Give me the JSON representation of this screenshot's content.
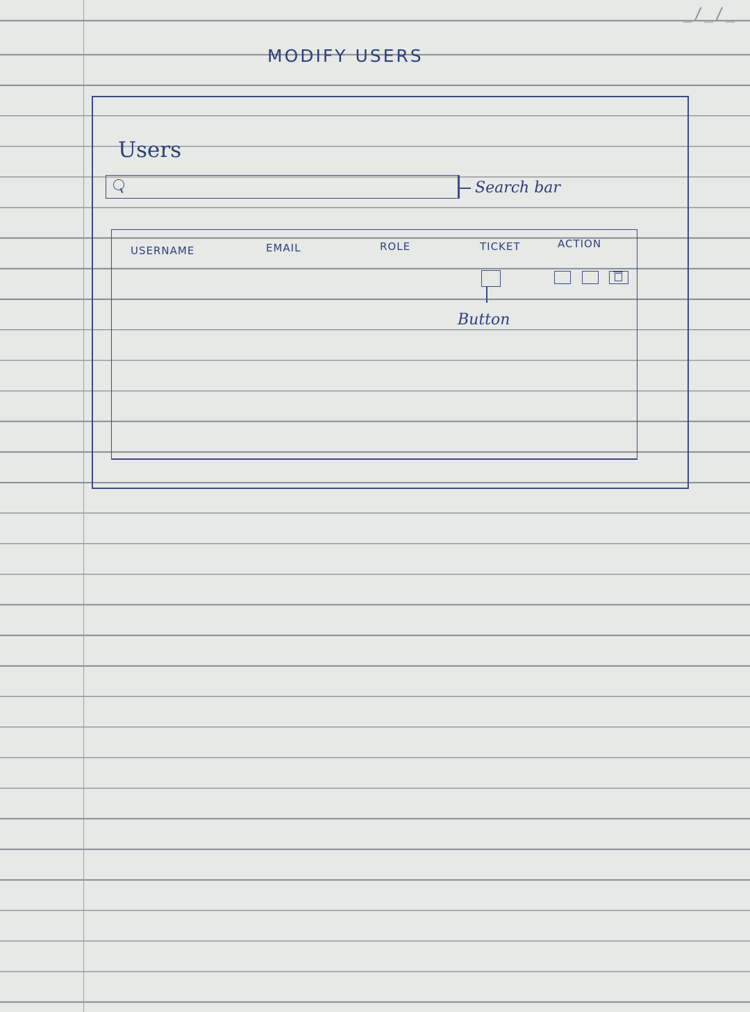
{
  "page": {
    "title": "MODIFY USERS",
    "date_field": "_/_/_"
  },
  "section": {
    "title": "Users"
  },
  "search": {
    "placeholder": "",
    "value": "",
    "annotation": "Search bar"
  },
  "table": {
    "columns": [
      "USERNAME",
      "EMAIL",
      "ROLE",
      "TICKET",
      "ACTION"
    ],
    "ticket_annotation": "Button"
  },
  "icons": {
    "search": "search-icon",
    "delete": "delete-icon"
  },
  "colors": {
    "paper": "#e6e9e6",
    "ink": "#2e3f7a",
    "rule": "#7f868a"
  }
}
